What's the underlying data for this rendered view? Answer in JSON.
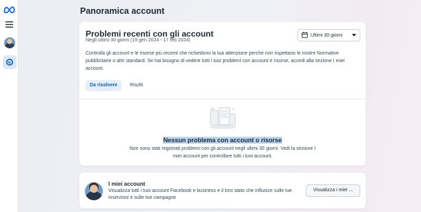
{
  "page": {
    "title": "Panoramica account"
  },
  "recent_problems": {
    "title": "Problemi recenti con gli account",
    "subtitle": "Negli ultimi 30 giorni (19 gen 2024 - 17 feb 2024)",
    "date_filter": "Ultimi 30 giorni",
    "description": "Controlla gli account e le risorse più recenti che richiedono la tua attenzione perché non rispettano le nostre Normative pubblicitarie o altri standard. Se hai bisogno di vedere tutti i tuoi problemi con account e risorse, accedi alla sezione I miei account.",
    "tabs": [
      {
        "label": "Da risolvere"
      },
      {
        "label": "Risolti"
      }
    ],
    "empty_state": {
      "title": "Nessun problema con account o risorse",
      "text": "Non sono stati registrati problemi con gli account negli ultimi 30 giorni. Vedi la sezione I miei account per controllare tutti i tuoi account."
    }
  },
  "my_accounts": {
    "title": "I miei account",
    "description": "Visualizza tutti i tuoi account Facebook e business e il loro stato che influisce sulle tue inserzioni e sulle tue campagne",
    "button": "Visualizza i miei ..."
  },
  "colors": {
    "accent": "#0a66c2",
    "active_tab_bg": "#e5effb",
    "highlight": "#bcd4ee"
  },
  "icons": [
    "meta-logo-icon",
    "menu-icon",
    "avatar",
    "account-overview-icon",
    "calendar-icon",
    "caret-down-icon"
  ]
}
